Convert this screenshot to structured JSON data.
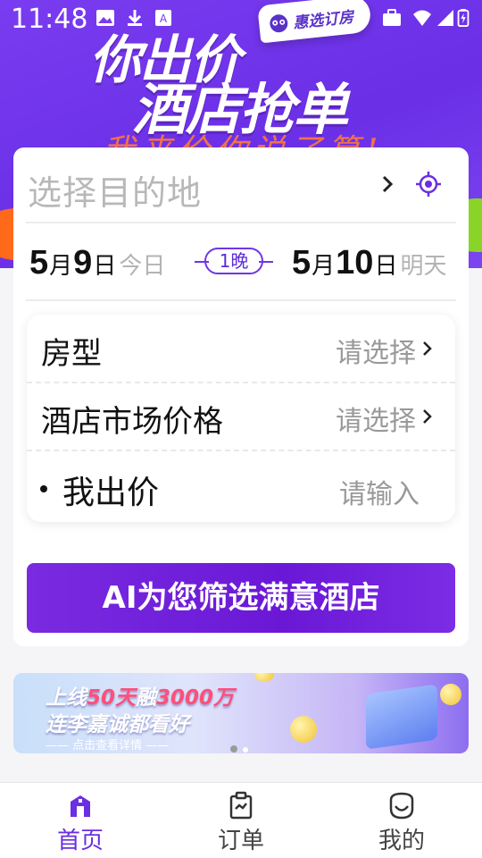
{
  "status_bar": {
    "time": "11:48"
  },
  "hero": {
    "headline_line1": "你出价",
    "headline_line2": "酒店抢单",
    "slogan": "我来价你说了算!",
    "brand": "惠选订房"
  },
  "search": {
    "destination_placeholder": "选择目的地",
    "checkin": {
      "month": "5",
      "month_unit": "月",
      "day": "9",
      "day_unit": "日",
      "relative": "今日"
    },
    "checkout": {
      "month": "5",
      "month_unit": "月",
      "day": "10",
      "day_unit": "日",
      "relative": "明天"
    },
    "nights": "1晚"
  },
  "options": {
    "room_type": {
      "label": "房型",
      "value": "请选择"
    },
    "market_price": {
      "label": "酒店市场价格",
      "value": "请选择"
    },
    "my_bid": {
      "label": "我出价",
      "placeholder": "请输入"
    }
  },
  "cta_label": "AI为您筛选满意酒店",
  "banner": {
    "line1_a": "上线",
    "line1_hi1": "50天",
    "line1_b": "融",
    "line1_hi2": "3000万",
    "line2": "连李嘉诚都看好",
    "line3": "—— 点击查看详情 ——"
  },
  "tabbar": {
    "items": [
      {
        "label": "首页",
        "icon": "home-icon",
        "active": true
      },
      {
        "label": "订单",
        "icon": "clipboard-icon",
        "active": false
      },
      {
        "label": "我的",
        "icon": "profile-icon",
        "active": false
      }
    ]
  },
  "colors": {
    "accent": "#6a2fe0",
    "hero": "#7a3cf0"
  }
}
